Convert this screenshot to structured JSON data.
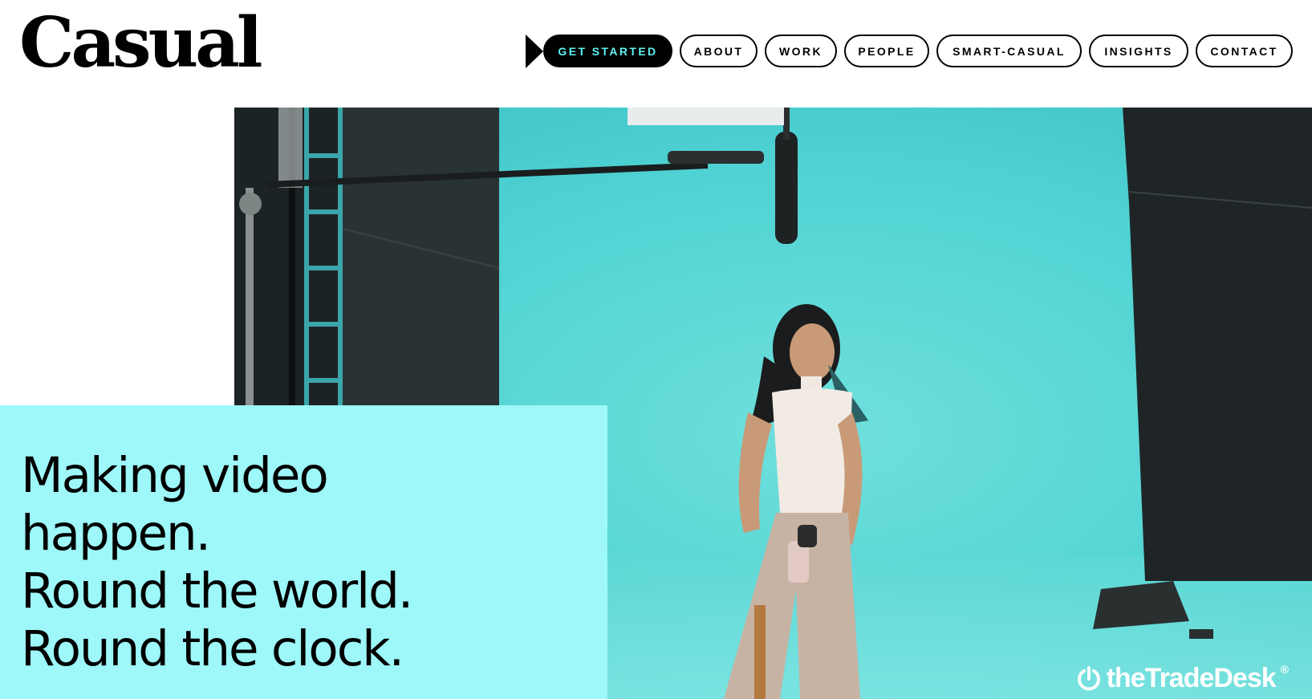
{
  "brand": {
    "logo_text": "Casual"
  },
  "nav": {
    "items": [
      {
        "label": "GET STARTED",
        "primary": true
      },
      {
        "label": "ABOUT"
      },
      {
        "label": "WORK"
      },
      {
        "label": "PEOPLE"
      },
      {
        "label": "SMART-CASUAL"
      },
      {
        "label": "INSIGHTS"
      },
      {
        "label": "CONTACT"
      }
    ],
    "arrow_icon": "play-arrow-icon"
  },
  "hero": {
    "headline_lines": [
      "Making video",
      "happen.",
      "Round the world.",
      "Round the clock."
    ],
    "video_watermark": "theTradeDesk",
    "watermark_mark": "®"
  },
  "colors": {
    "accent_cyan": "#5ff3f3",
    "panel_cyan": "#9ef7f9",
    "studio_backdrop": "#4fd2d3",
    "black": "#000000"
  }
}
